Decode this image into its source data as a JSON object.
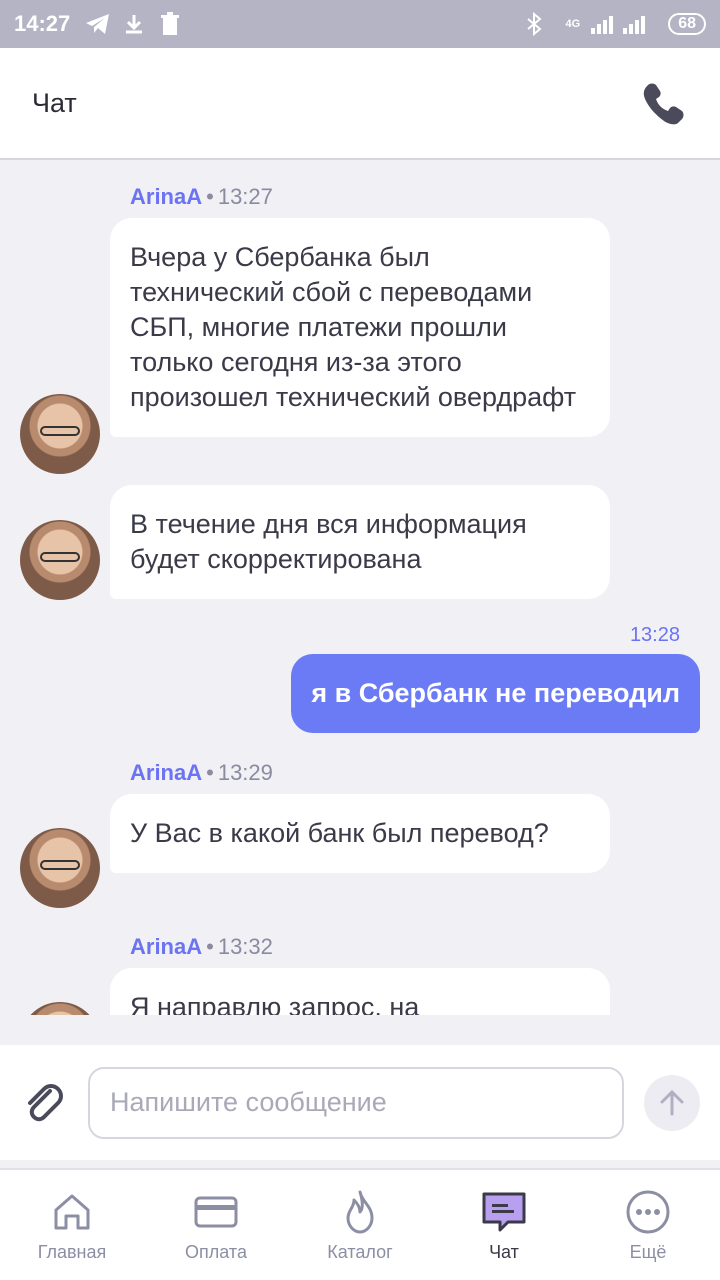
{
  "status_bar": {
    "time": "14:27",
    "network": "4G",
    "battery": "68",
    "left_icons": [
      "telegram-icon",
      "download-icon",
      "trash-icon"
    ],
    "right_icons": [
      "bluetooth-icon",
      "signal-icon",
      "battery-icon"
    ]
  },
  "header": {
    "title": "Чат",
    "call_icon": "phone-icon"
  },
  "messages": [
    {
      "author": "ArinaA",
      "time": "13:27",
      "text": "Вчера у Сбербанка был технический сбой с переводами СБП, многие платежи прошли только сегодня из-за этого произошел технический овердрафт"
    },
    {
      "text": "В течение дня вся информация будет скорректирована"
    },
    {
      "outgoing": true,
      "time": "13:28",
      "text": "я в Сбербанк не переводил"
    },
    {
      "author": "ArinaA",
      "time": "13:29",
      "text": "У Вас в какой банк был перевод?"
    },
    {
      "author": "ArinaA",
      "time": "13:32",
      "text": "Я направлю запрос, на"
    }
  ],
  "input": {
    "placeholder": "Напишите сообщение",
    "attach_icon": "paperclip-icon",
    "send_icon": "arrow-up-icon"
  },
  "nav": {
    "items": [
      {
        "label": "Главная",
        "icon": "home-icon"
      },
      {
        "label": "Оплата",
        "icon": "card-icon"
      },
      {
        "label": "Каталог",
        "icon": "flame-icon"
      },
      {
        "label": "Чат",
        "icon": "chat-icon",
        "active": true
      },
      {
        "label": "Ещё",
        "icon": "more-icon"
      }
    ]
  },
  "colors": {
    "accent": "#6b73f2",
    "outgoing_bubble": "#6b7bf5",
    "status_bar": "#b5b4c4",
    "chat_bg": "#f0f0f5"
  }
}
